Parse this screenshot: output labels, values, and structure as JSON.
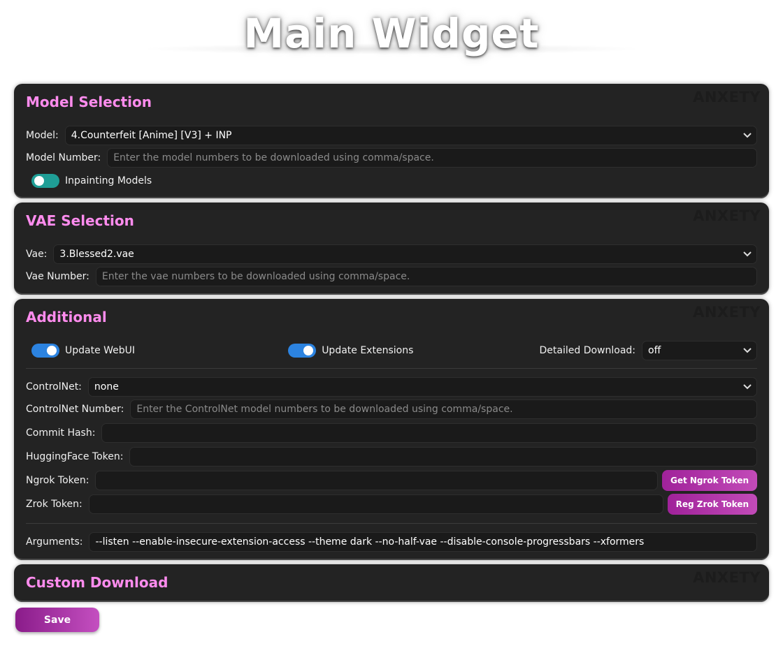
{
  "header": {
    "title": "Main Widget"
  },
  "watermark": "ANXETY",
  "model_panel": {
    "title": "Model Selection",
    "model_label": "Model:",
    "model_value": "4.Counterfeit [Anime] [V3] + INP",
    "number_label": "Model Number:",
    "number_placeholder": "Enter the model numbers to be downloaded using comma/space.",
    "inpainting_label": "Inpainting Models"
  },
  "vae_panel": {
    "title": "VAE Selection",
    "vae_label": "Vae:",
    "vae_value": "3.Blessed2.vae",
    "number_label": "Vae Number:",
    "number_placeholder": "Enter the vae numbers to be downloaded using comma/space."
  },
  "additional_panel": {
    "title": "Additional",
    "update_webui_label": "Update WebUI",
    "update_extensions_label": "Update Extensions",
    "detailed_download_label": "Detailed Download:",
    "detailed_download_value": "off",
    "controlnet_label": "ControlNet:",
    "controlnet_value": "none",
    "controlnet_number_label": "ControlNet Number:",
    "controlnet_number_placeholder": "Enter the ControlNet model numbers to be downloaded using comma/space.",
    "commit_hash_label": "Commit Hash:",
    "commit_hash_value": "",
    "huggingface_label": "HuggingFace Token:",
    "huggingface_value": "",
    "ngrok_label": "Ngrok Token:",
    "ngrok_value": "",
    "ngrok_button": "Get Ngrok Token",
    "zrok_label": "Zrok Token:",
    "zrok_value": "",
    "zrok_button": "Reg Zrok Token",
    "arguments_label": "Arguments:",
    "arguments_value": "--listen --enable-insecure-extension-access --theme dark --no-half-vae --disable-console-progressbars --xformers"
  },
  "custom_panel": {
    "title": "Custom Download"
  },
  "save_button": "Save",
  "colors": {
    "panel_bg": "#232323",
    "title_pink": "#ff8cee",
    "toggle_teal": "#1f9e96",
    "toggle_blue": "#2c83e0",
    "button_purple": "#a0229a"
  }
}
